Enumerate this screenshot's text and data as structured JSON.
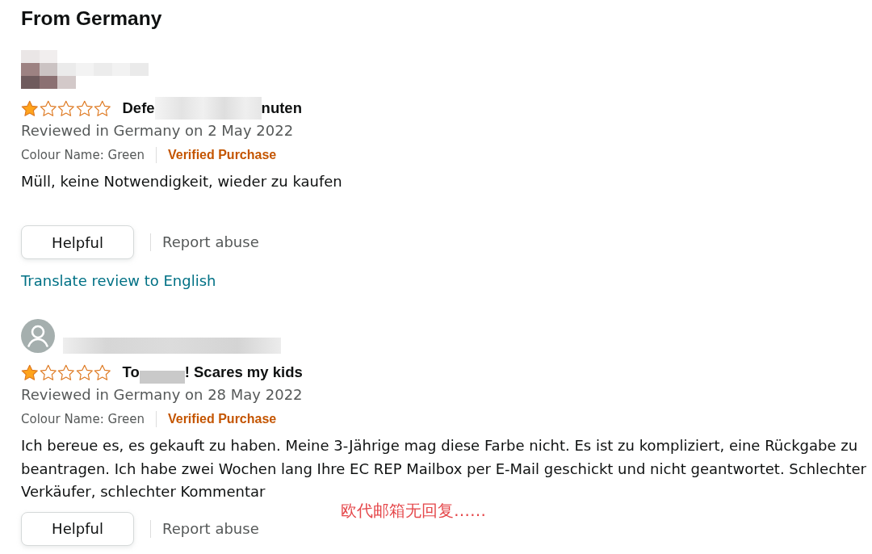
{
  "section": {
    "title": "From Germany"
  },
  "reviews": [
    {
      "avatar": {
        "kind": "blurred"
      },
      "stars": 1,
      "title_parts": [
        "Defe",
        "nuten"
      ],
      "date_line": "Reviewed in Germany on 2 May 2022",
      "variant": "Colour Name: Green",
      "badge": "Verified Purchase",
      "body": "Müll, keine Notwendigkeit, wieder zu kaufen",
      "helpful_button": "Helpful",
      "report_link": "Report abuse",
      "translate_link": "Translate review to English"
    },
    {
      "avatar": {
        "kind": "silhouette"
      },
      "stars": 1,
      "title_parts": [
        "To",
        "! Scares my kids"
      ],
      "date_line": "Reviewed in Germany on 28 May 2022",
      "variant": "Colour Name: Green",
      "badge": "Verified Purchase",
      "body": "Ich bereue es, es gekauft zu haben. Meine 3-Jährige mag diese Farbe nicht. Es ist zu kompliziert, eine Rückgabe zu beantragen. Ich habe zwei Wochen lang Ihre EC REP Mailbox per E-Mail geschickt und nicht geantwortet. Schlechter Verkäufer, schlechter Kommentar",
      "annotation": "欧代邮箱无回复……",
      "helpful_button": "Helpful",
      "report_link": "Report abuse"
    }
  ]
}
